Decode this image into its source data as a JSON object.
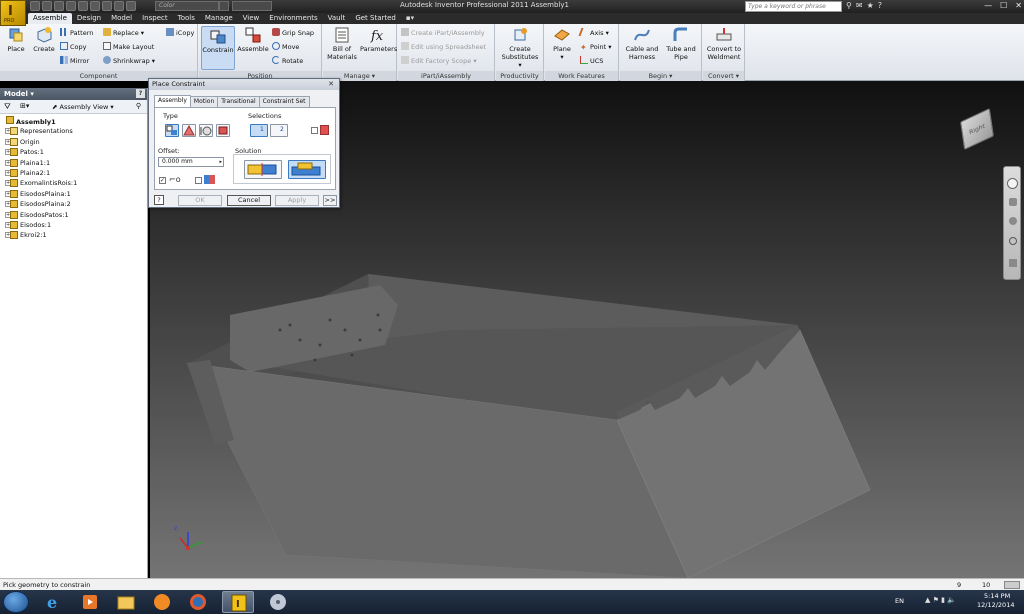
{
  "app": {
    "title": "Autodesk Inventor Professional 2011   Assembly1",
    "logo_text": "I",
    "logo_sub": "PRO",
    "color_placeholder": "Color",
    "search_placeholder": "Type a keyword or phrase"
  },
  "tabs": [
    "Assemble",
    "Design",
    "Model",
    "Inspect",
    "Tools",
    "Manage",
    "View",
    "Environments",
    "Vault",
    "Get Started"
  ],
  "ribbon": {
    "component": {
      "label": "Component",
      "place": "Place",
      "create": "Create",
      "pattern": "Pattern",
      "copy": "Copy",
      "mirror": "Mirror",
      "replace": "Replace",
      "make_layout": "Make Layout",
      "shrinkwrap": "Shrinkwrap",
      "icopy": "iCopy"
    },
    "position": {
      "label": "Position",
      "constrain": "Constrain",
      "assemble": "Assemble",
      "grip_snap": "Grip Snap",
      "move": "Move",
      "rotate": "Rotate"
    },
    "manage": {
      "label": "Manage",
      "bom_1": "Bill of",
      "bom_2": "Materials",
      "parameters": "Parameters"
    },
    "ipart": {
      "label": "iPart/iAssembly",
      "create": "Create iPart/iAssembly",
      "edit_spreadsheet": "Edit using Spreadsheet",
      "edit_factory": "Edit Factory Scope"
    },
    "productivity": {
      "label": "Productivity",
      "create_1": "Create",
      "create_2": "Substitutes"
    },
    "work_features": {
      "label": "Work Features",
      "plane": "Plane",
      "axis": "Axis",
      "point": "Point",
      "ucs": "UCS"
    },
    "begin": {
      "label": "Begin",
      "cable_1": "Cable and",
      "cable_2": "Harness",
      "tube_1": "Tube and",
      "tube_2": "Pipe"
    },
    "convert": {
      "label": "Convert",
      "conv_1": "Convert to",
      "conv_2": "Weldment"
    }
  },
  "browser": {
    "title": "Model",
    "view": "Assembly View",
    "root": "Assembly1",
    "items": [
      "Representations",
      "Origin",
      "Patos:1",
      "Plaina1:1",
      "Plaina2:1",
      "ExomalintisRois:1",
      "EisodosPlaina:1",
      "EisodosPlaina:2",
      "EisodosPatos:1",
      "Eisodos:1",
      "Ekroi2:1"
    ]
  },
  "dialog": {
    "title": "Place Constraint",
    "tabs": [
      "Assembly",
      "Motion",
      "Transitional",
      "Constraint Set"
    ],
    "type_label": "Type",
    "selections_label": "Selections",
    "sel1": "1",
    "sel2": "2",
    "offset_label": "Offset:",
    "offset_value": "0.000 mm",
    "solution_label": "Solution",
    "ok": "OK",
    "cancel": "Cancel",
    "apply": "Apply",
    "more": ">>",
    "help": "?"
  },
  "viewcube": {
    "face": "Right"
  },
  "status": {
    "text": "Pick geometry to constrain",
    "num1": "9",
    "num2": "10"
  },
  "taskbar": {
    "lang": "EN",
    "time": "5:14 PM",
    "date": "12/12/2014"
  },
  "colors": {
    "ribbon_bg": "#e9ecf1",
    "active_blue": "#c9dcf3",
    "viewport_top": "#101010",
    "viewport_bottom": "#747474",
    "taskbar": "#1f2c40"
  }
}
